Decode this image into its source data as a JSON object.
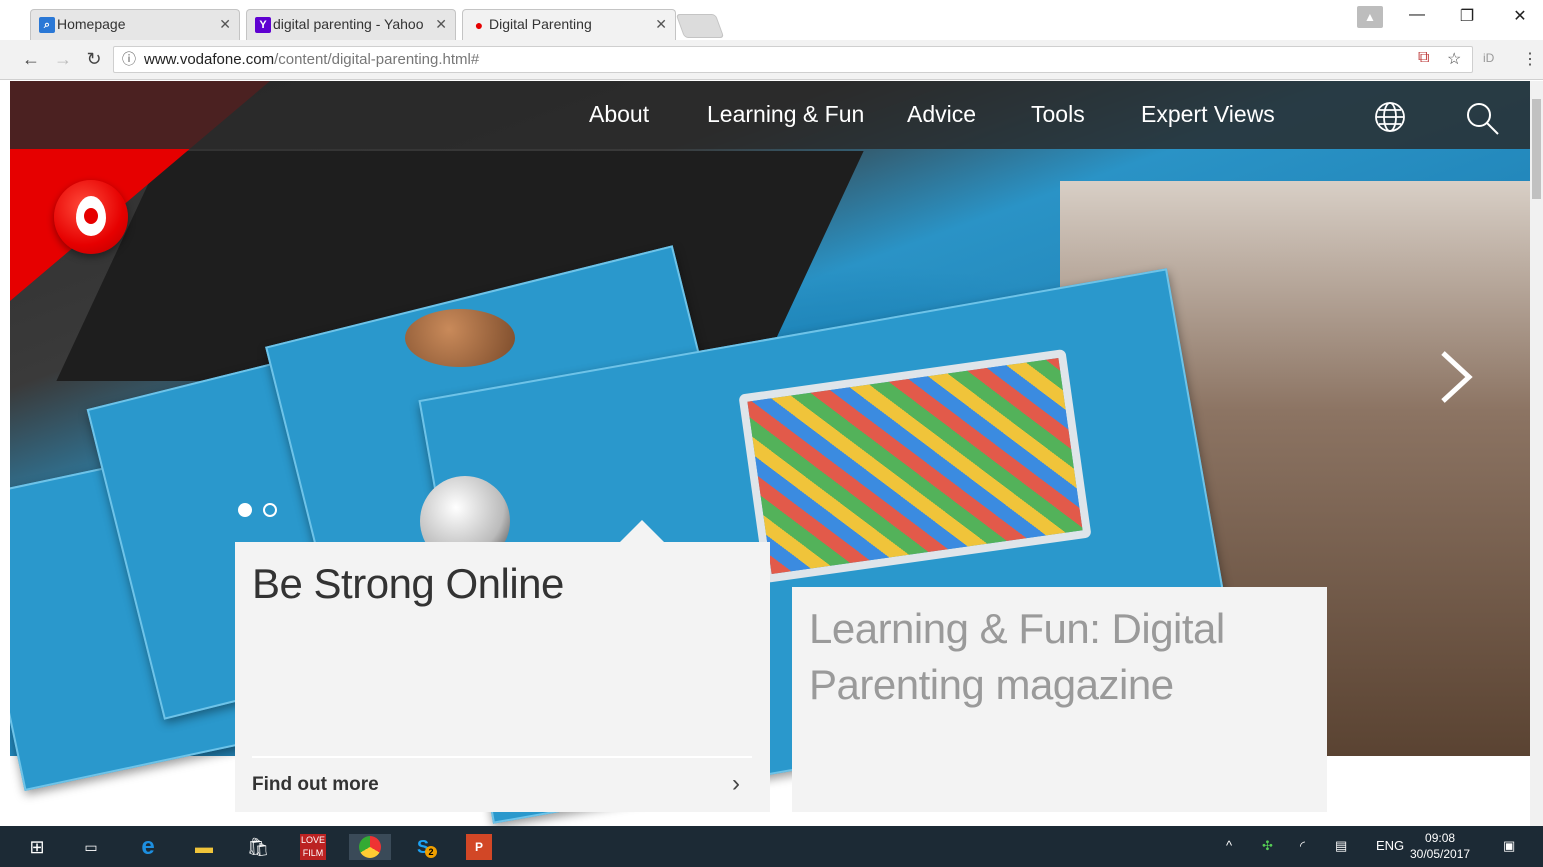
{
  "browser": {
    "tabs": [
      {
        "title": "Homepage",
        "favicon": "search-icon",
        "favicon_color": "#2a78d6"
      },
      {
        "title": "digital parenting - Yahoo",
        "favicon": "yahoo-icon",
        "favicon_color": "#5f01d1"
      },
      {
        "title": "Digital Parenting",
        "favicon": "vodafone-icon",
        "favicon_color": "#e60000"
      }
    ],
    "address": {
      "host": "www.vodafone.com",
      "path": "/content/digital-parenting.html#"
    },
    "extension_label": "iD"
  },
  "site": {
    "brand_color": "#e60000",
    "nav": [
      "About",
      "Learning & Fun",
      "Advice",
      "Tools",
      "Expert Views"
    ],
    "carousel_slides": 2,
    "carousel_active": 1
  },
  "cards": {
    "primary": {
      "title": "Be Strong Online",
      "cta": "Find out more"
    },
    "secondary": {
      "title": "Learning & Fun: Digital Parenting magazine"
    }
  },
  "taskbar": {
    "tray_lang": "ENG",
    "time": "09:08",
    "date": "30/05/2017",
    "skype_badge": "2"
  }
}
